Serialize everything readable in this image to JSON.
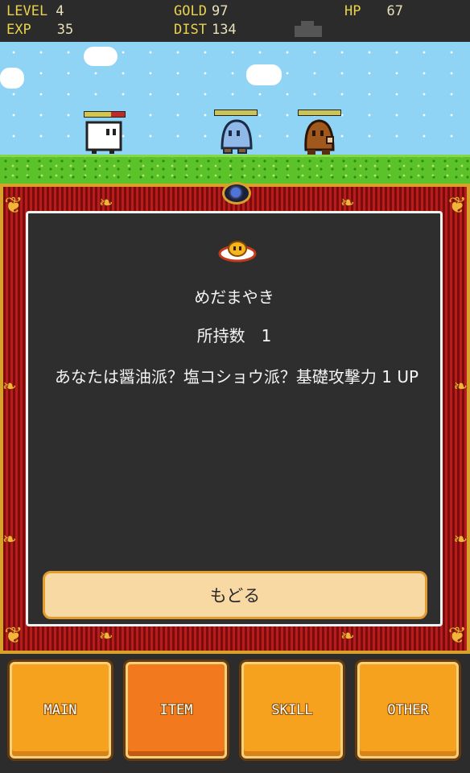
{
  "hud": {
    "level_label": "LEVEL",
    "level_value": "4",
    "exp_label": "EXP",
    "exp_value": "35",
    "gold_label": "GOLD",
    "gold_value": "97",
    "dist_label": "DIST",
    "dist_value": "134",
    "hp_label": "HP",
    "hp_value": "67"
  },
  "scene": {
    "player": {
      "name_icon": "tofu-hero-icon",
      "hp_fraction": 0.65
    },
    "enemies": [
      {
        "icon": "ghost-enemy-icon",
        "hp_fraction": 1.0
      },
      {
        "icon": "potato-enemy-icon",
        "hp_fraction": 1.0
      }
    ]
  },
  "dialog": {
    "icon": "fried-egg-icon",
    "item_name": "めだまやき",
    "count_text": "所持数　1",
    "description": "あなたは醤油派？塩コショウ派？基礎攻撃力 1 UP",
    "back_label": "もどる"
  },
  "menu": {
    "buttons": [
      {
        "label": "MAIN"
      },
      {
        "label": "ITEM",
        "active": true
      },
      {
        "label": "SKILL"
      },
      {
        "label": "OTHER"
      }
    ]
  },
  "colors": {
    "hud_label": "#e9d24a",
    "sky": "#8fd3f5",
    "grass": "#5cc22a",
    "frame_red": "#b81c1c",
    "frame_gold": "#d8a22a",
    "button_orange": "#f7a21e",
    "button_active": "#f2791e"
  }
}
